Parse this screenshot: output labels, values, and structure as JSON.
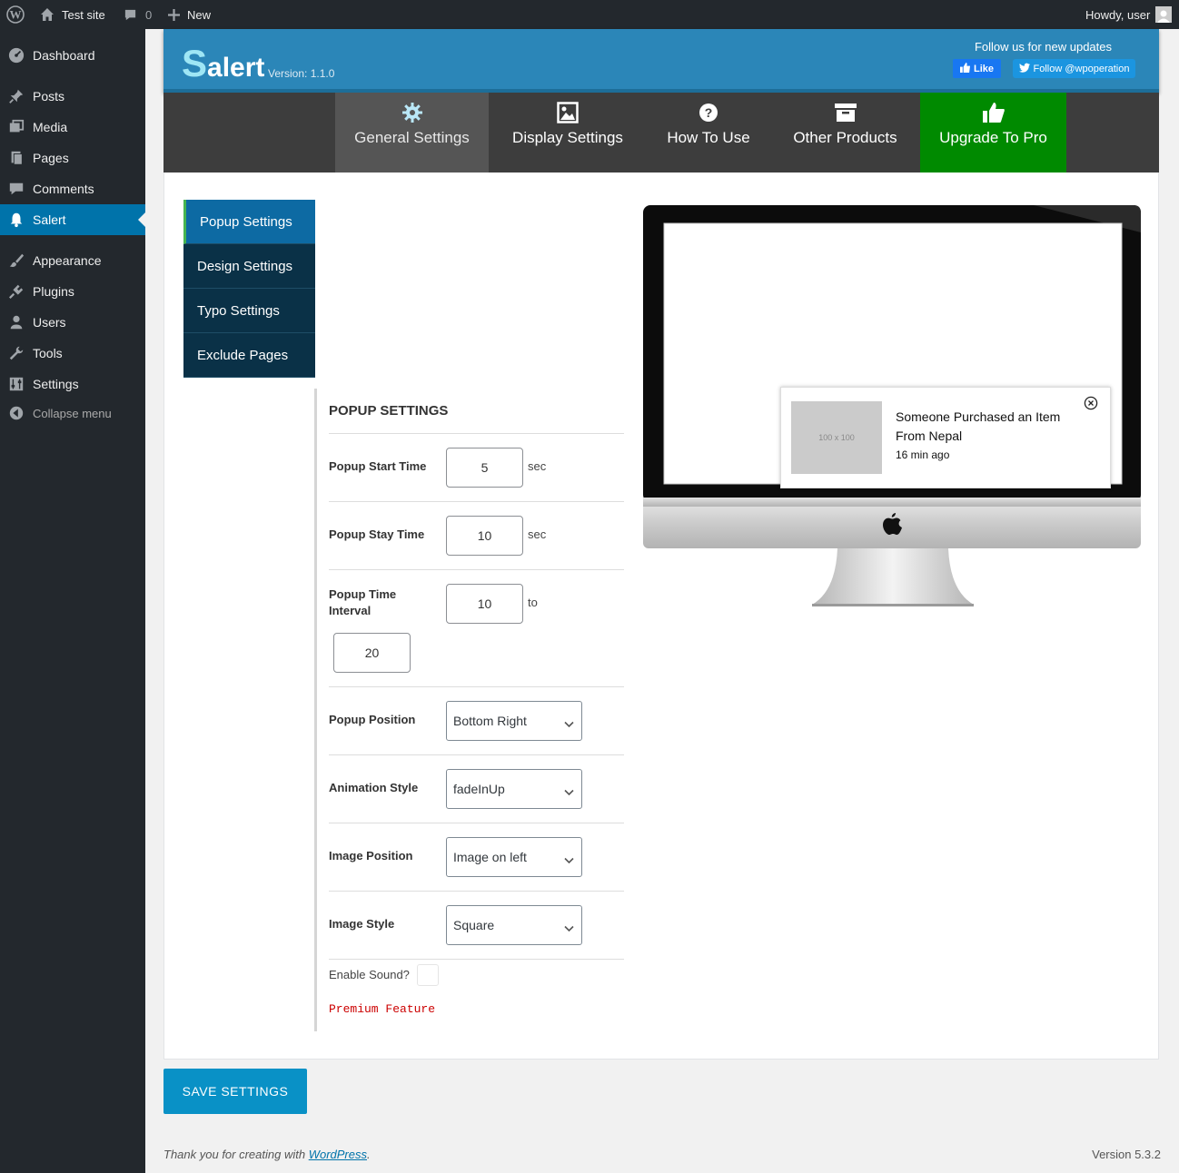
{
  "adminbar": {
    "site_name": "Test site",
    "comments_count": "0",
    "new_label": "New",
    "howdy": "Howdy, user"
  },
  "sidebar": {
    "items": [
      {
        "label": "Dashboard",
        "icon": "dashboard-icon"
      },
      {
        "label": "Posts",
        "icon": "pin-icon"
      },
      {
        "label": "Media",
        "icon": "media-icon"
      },
      {
        "label": "Pages",
        "icon": "pages-icon"
      },
      {
        "label": "Comments",
        "icon": "comment-icon"
      },
      {
        "label": "Salert",
        "icon": "bell-icon",
        "current": true
      },
      {
        "label": "Appearance",
        "icon": "brush-icon"
      },
      {
        "label": "Plugins",
        "icon": "plug-icon"
      },
      {
        "label": "Users",
        "icon": "user-icon"
      },
      {
        "label": "Tools",
        "icon": "wrench-icon"
      },
      {
        "label": "Settings",
        "icon": "sliders-icon"
      }
    ],
    "collapse_label": "Collapse menu"
  },
  "header": {
    "logo_first": "S",
    "logo_rest": "alert",
    "version": "Version: 1.1.0",
    "follow_text": "Follow us for new updates",
    "like_label": "Like",
    "twitter_label": "Follow @wpoperation"
  },
  "tabs": [
    {
      "label": "General Settings",
      "icon": "gear-icon",
      "active": true
    },
    {
      "label": "Display Settings",
      "icon": "image-icon"
    },
    {
      "label": "How To Use",
      "icon": "question-icon"
    },
    {
      "label": "Other Products",
      "icon": "archive-icon"
    },
    {
      "label": "Upgrade To Pro",
      "icon": "thumbs-up-icon"
    }
  ],
  "subnav": [
    {
      "label": "Popup Settings",
      "active": true
    },
    {
      "label": "Design Settings"
    },
    {
      "label": "Typo Settings"
    },
    {
      "label": "Exclude Pages"
    }
  ],
  "form": {
    "title": "POPUP SETTINGS",
    "start_time": {
      "label": "Popup Start Time",
      "value": "5",
      "unit": "sec"
    },
    "stay_time": {
      "label": "Popup Stay Time",
      "value": "10",
      "unit": "sec"
    },
    "interval": {
      "label": "Popup Time Interval",
      "from": "10",
      "to_label": "to",
      "to": "20"
    },
    "position": {
      "label": "Popup Position",
      "value": "Bottom Right"
    },
    "animation": {
      "label": "Animation Style",
      "value": "fadeInUp"
    },
    "image_position": {
      "label": "Image Position",
      "value": "Image on left"
    },
    "image_style": {
      "label": "Image Style",
      "value": "Square"
    },
    "sound": {
      "label": "Enable Sound?",
      "checked": false
    },
    "premium": "Premium Feature"
  },
  "preview": {
    "placeholder": "100 x 100",
    "message": "Someone Purchased an Item From Nepal",
    "time": "16 min ago"
  },
  "save_label": "SAVE SETTINGS",
  "footer": {
    "thanks_prefix": "Thank you for creating with ",
    "wp_link": "WordPress",
    "thanks_suffix": ".",
    "version": "Version 5.3.2"
  },
  "colors": {
    "admin_dark": "#23282d",
    "accent": "#0073aa",
    "header_blue": "#2b86b8",
    "pro_green": "#008a00",
    "premium_red": "#cc0000"
  }
}
